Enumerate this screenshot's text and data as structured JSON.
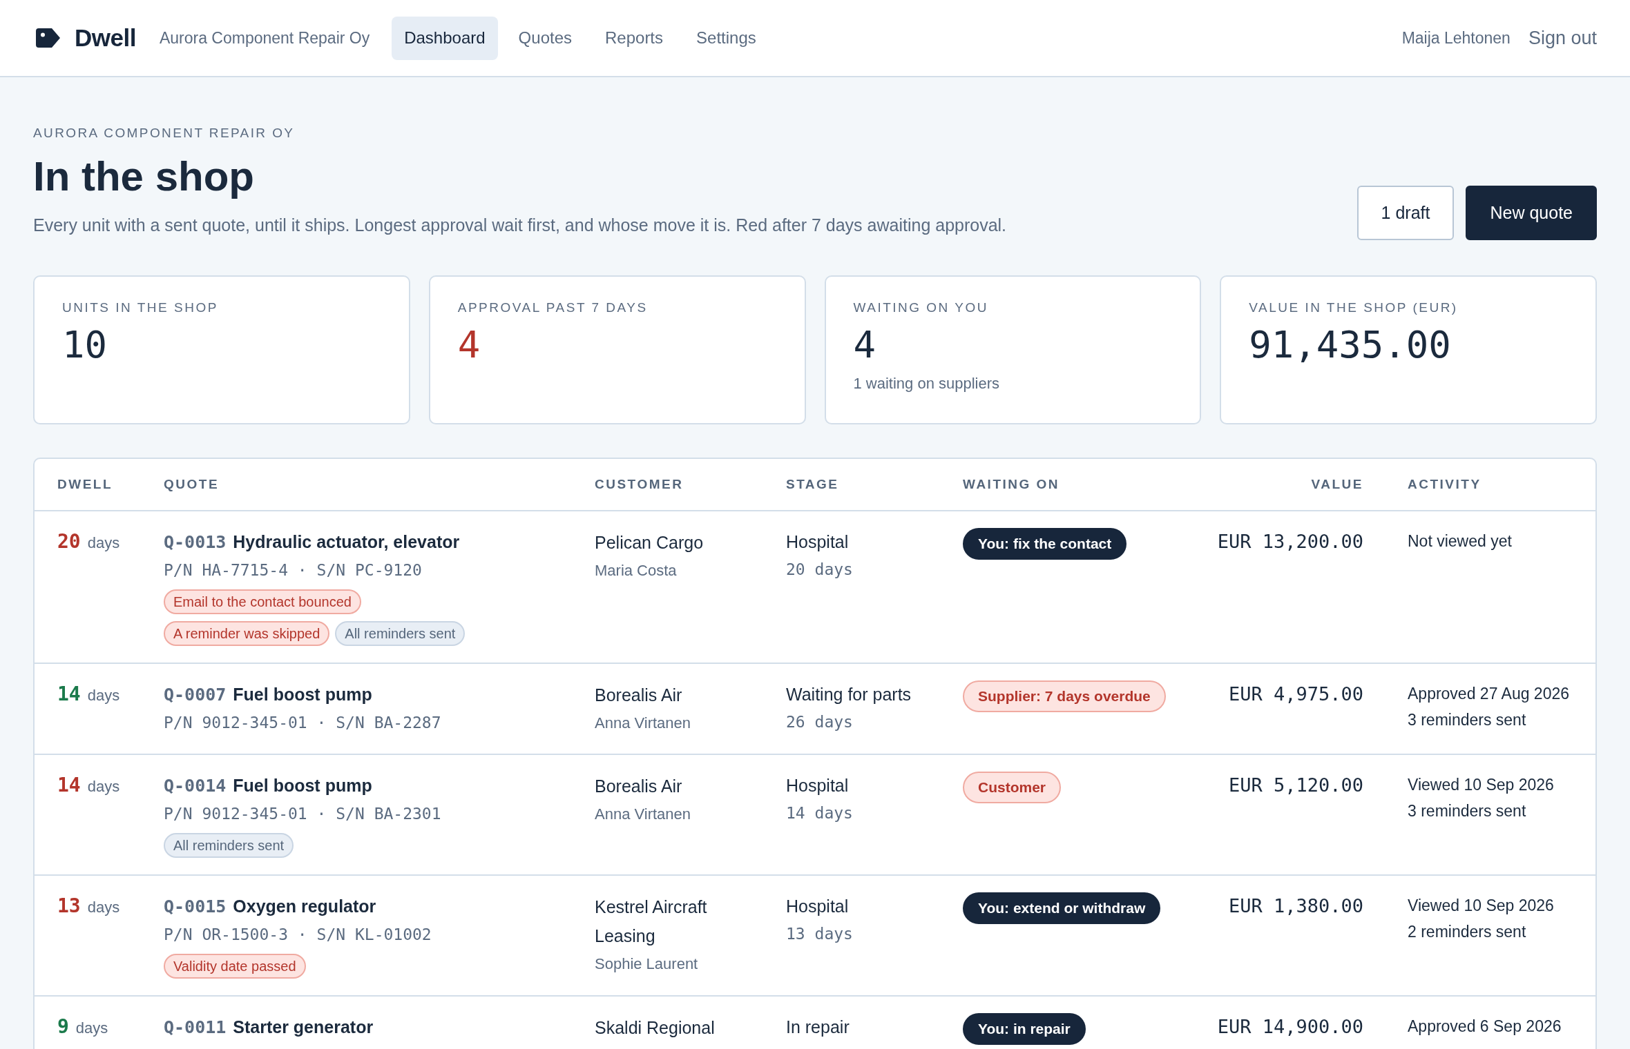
{
  "header": {
    "brand": "Dwell",
    "company": "Aurora Component Repair Oy",
    "nav": [
      {
        "label": "Dashboard",
        "selected": true
      },
      {
        "label": "Quotes",
        "selected": false
      },
      {
        "label": "Reports",
        "selected": false
      },
      {
        "label": "Settings",
        "selected": false
      }
    ],
    "user": "Maija Lehtonen",
    "sign_out": "Sign out"
  },
  "page": {
    "eyebrow": "AURORA COMPONENT REPAIR OY",
    "title": "In the shop",
    "description": "Every unit with a sent quote, until it ships. Longest approval wait first, and whose move it is. Red after 7 days awaiting approval.",
    "actions": [
      {
        "label": "1 draft",
        "kind": "outline"
      },
      {
        "label": "New quote",
        "kind": "filled"
      }
    ]
  },
  "stats": [
    {
      "label": "UNITS IN THE SHOP",
      "value": "10",
      "alert": false
    },
    {
      "label": "APPROVAL PAST 7 DAYS",
      "value": "4",
      "alert": true
    },
    {
      "label": "WAITING ON YOU",
      "value": "4",
      "alert": false,
      "note": "1 waiting on suppliers"
    },
    {
      "label": "VALUE IN THE SHOP (EUR)",
      "value": "91,435.00",
      "alert": false
    }
  ],
  "table": {
    "columns": [
      "DWELL",
      "QUOTE",
      "CUSTOMER",
      "STAGE",
      "WAITING ON",
      "VALUE",
      "ACTIVITY"
    ],
    "rows": [
      {
        "dwell": "20",
        "dwell_unit": "days",
        "overdue": true,
        "quote_id": "Q-0013",
        "item": "Hydraulic actuator, elevator",
        "serials": "P/N HA-7715-4 · S/N PC-9120",
        "flags": [
          {
            "label": "Email to the contact bounced",
            "kind": "alert"
          },
          {
            "label": "A reminder was skipped",
            "kind": "alert"
          },
          {
            "label": "All reminders sent",
            "kind": "info"
          }
        ],
        "customer": "Pelican Cargo",
        "contact": "Maria Costa",
        "stage": "Hospital",
        "stage_time": "20 days",
        "waiting": {
          "label": "You: fix the contact",
          "kind": "you"
        },
        "value": "EUR 13,200.00",
        "activity": [
          "Not viewed yet"
        ]
      },
      {
        "dwell": "14",
        "dwell_unit": "days",
        "overdue": false,
        "quote_id": "Q-0007",
        "item": "Fuel boost pump",
        "serials": "P/N 9012-345-01 · S/N BA-2287",
        "customer": "Borealis Air",
        "contact": "Anna Virtanen",
        "stage": "Waiting for parts",
        "stage_time": "26 days",
        "waiting": {
          "label": "Supplier: 7 days overdue",
          "kind": "alert"
        },
        "value": "EUR 4,975.00",
        "activity": [
          "Approved 27 Aug 2026",
          "3 reminders sent"
        ]
      },
      {
        "dwell": "14",
        "dwell_unit": "days",
        "overdue": true,
        "quote_id": "Q-0014",
        "item": "Fuel boost pump",
        "serials": "P/N 9012-345-01 · S/N BA-2301",
        "flags": [
          {
            "label": "All reminders sent",
            "kind": "info"
          }
        ],
        "customer": "Borealis Air",
        "contact": "Anna Virtanen",
        "stage": "Hospital",
        "stage_time": "14 days",
        "waiting": {
          "label": "Customer",
          "kind": "alert"
        },
        "value": "EUR 5,120.00",
        "activity": [
          "Viewed 10 Sep 2026",
          "3 reminders sent"
        ]
      },
      {
        "dwell": "13",
        "dwell_unit": "days",
        "overdue": true,
        "quote_id": "Q-0015",
        "item": "Oxygen regulator",
        "serials": "P/N OR-1500-3 · S/N KL-01002",
        "flags": [
          {
            "label": "Validity date passed",
            "kind": "alert"
          }
        ],
        "customer": "Kestrel Aircraft Leasing",
        "contact": "Sophie Laurent",
        "stage": "Hospital",
        "stage_time": "13 days",
        "waiting": {
          "label": "You: extend or withdraw",
          "kind": "you"
        },
        "value": "EUR 1,380.00",
        "activity": [
          "Viewed 10 Sep 2026",
          "2 reminders sent"
        ]
      },
      {
        "dwell": "9",
        "dwell_unit": "days",
        "overdue": false,
        "quote_id": "Q-0011",
        "item": "Starter generator",
        "customer": "Skaldi Regional",
        "stage": "In repair",
        "waiting": {
          "label": "You: in repair",
          "kind": "you"
        },
        "value": "EUR 14,900.00",
        "activity": [
          "Approved 6 Sep 2026"
        ]
      }
    ]
  }
}
